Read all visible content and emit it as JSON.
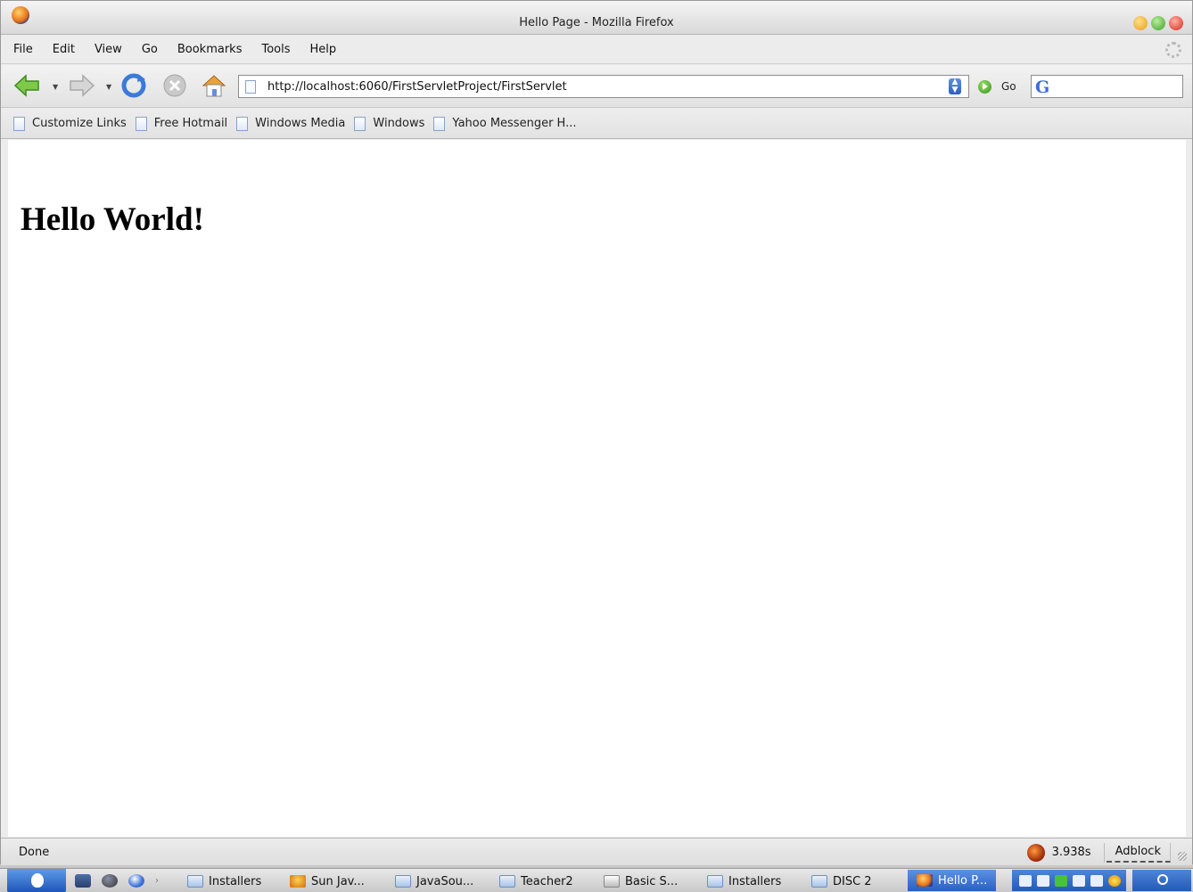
{
  "window": {
    "title": "Hello Page - Mozilla Firefox"
  },
  "menu": {
    "items": [
      "File",
      "Edit",
      "View",
      "Go",
      "Bookmarks",
      "Tools",
      "Help"
    ]
  },
  "toolbar": {
    "url": "http://localhost:6060/FirstServletProject/FirstServlet",
    "go_label": "Go"
  },
  "bookmarks": {
    "items": [
      "Customize Links",
      "Free Hotmail",
      "Windows Media",
      "Windows",
      "Yahoo Messenger H..."
    ]
  },
  "page": {
    "heading": "Hello World!"
  },
  "status": {
    "text": "Done",
    "timing": "3.938s",
    "adblock": "Adblock"
  },
  "taskbar": {
    "tasks": [
      {
        "label": "Installers",
        "icon": "folder-icon"
      },
      {
        "label": "Sun Jav...",
        "icon": "java-icon"
      },
      {
        "label": "JavaSou...",
        "icon": "folder-icon"
      },
      {
        "label": "Teacher2",
        "icon": "folder-icon"
      },
      {
        "label": "Basic S...",
        "icon": "document-icon"
      },
      {
        "label": "Installers",
        "icon": "folder-icon"
      },
      {
        "label": "DISC 2",
        "icon": "folder-icon"
      },
      {
        "label": "Hello P...",
        "icon": "firefox-icon"
      }
    ]
  },
  "colors": {
    "active_task": "#2a5fc4",
    "page_background": "#ffffff"
  }
}
